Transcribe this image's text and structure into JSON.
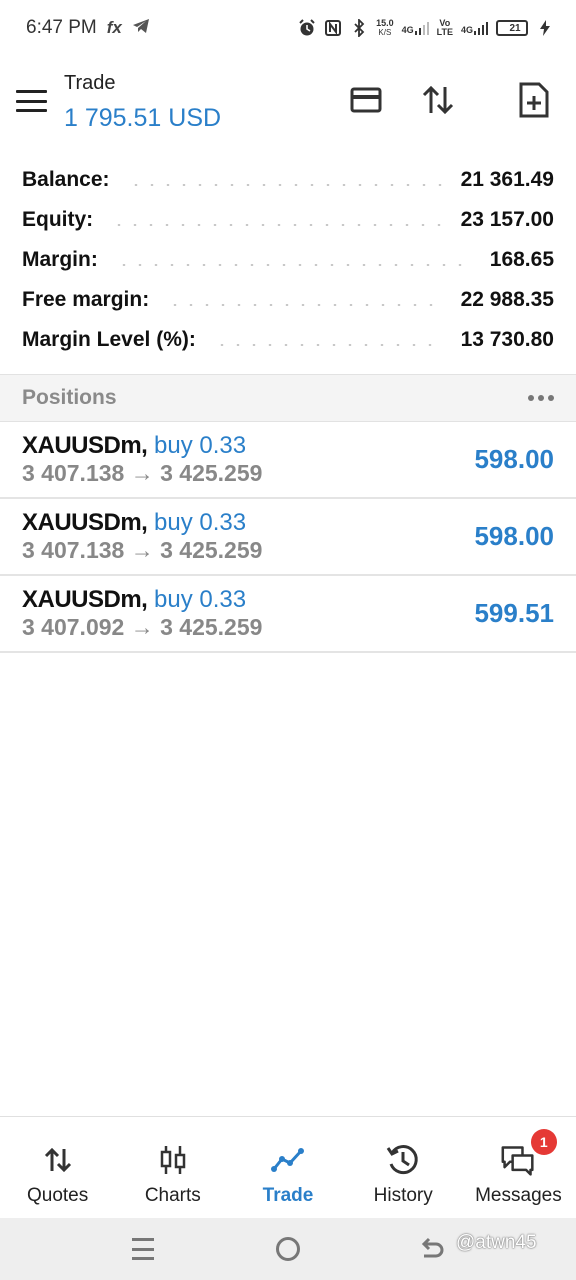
{
  "status_bar": {
    "time": "6:47 PM",
    "left_icons": [
      "fx-icon",
      "telegram-icon"
    ],
    "fx_label": "fx",
    "net_speed_value": "15.0",
    "net_speed_unit": "K/S",
    "signal1_label": "4G",
    "volte_top": "Vo",
    "volte_bottom": "LTE",
    "signal2_label": "4G",
    "battery_level": "21",
    "battery_color": "#2bb24c"
  },
  "header": {
    "title": "Trade",
    "balance_display": "1 795.51 USD",
    "accent_color": "#2a7fc9"
  },
  "summary": [
    {
      "label": "Balance:",
      "value": "21 361.49"
    },
    {
      "label": "Equity:",
      "value": "23 157.00"
    },
    {
      "label": "Margin:",
      "value": "168.65"
    },
    {
      "label": "Free margin:",
      "value": "22 988.35"
    },
    {
      "label": "Margin Level (%):",
      "value": "13 730.80"
    }
  ],
  "positions_header": {
    "title": "Positions"
  },
  "positions": [
    {
      "symbol": "XAUUSDm,",
      "side": "buy 0.33",
      "prices": "3 407.138 → 3 425.259",
      "profit": "598.00"
    },
    {
      "symbol": "XAUUSDm,",
      "side": "buy 0.33",
      "prices": "3 407.138 → 3 425.259",
      "profit": "598.00"
    },
    {
      "symbol": "XAUUSDm,",
      "side": "buy 0.33",
      "prices": "3 407.092 → 3 425.259",
      "profit": "599.51"
    }
  ],
  "bottom_nav": {
    "items": [
      {
        "label": "Quotes",
        "icon": "quotes-icon"
      },
      {
        "label": "Charts",
        "icon": "charts-icon"
      },
      {
        "label": "Trade",
        "icon": "trade-icon",
        "active": true
      },
      {
        "label": "History",
        "icon": "history-icon"
      },
      {
        "label": "Messages",
        "icon": "messages-icon",
        "badge": "1"
      }
    ]
  },
  "watermark": "@atwn45"
}
